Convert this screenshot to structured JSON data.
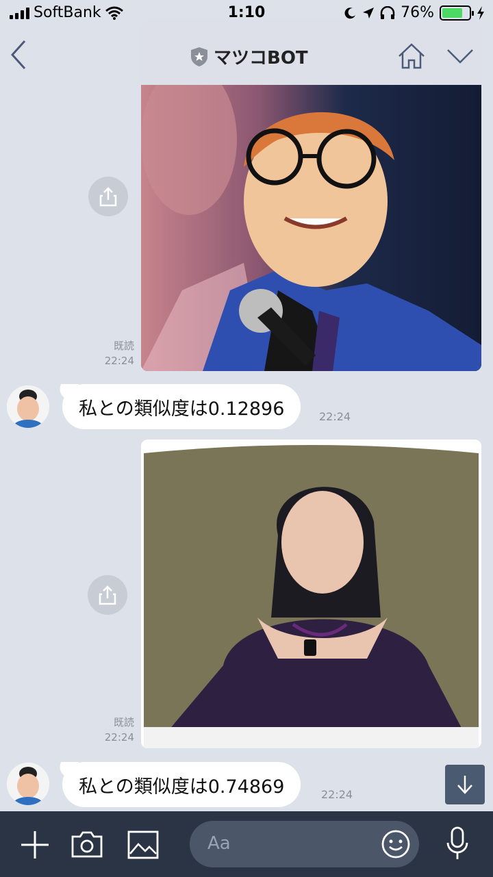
{
  "status_bar": {
    "carrier": "SoftBank",
    "time": "1:10",
    "battery": "76%",
    "battery_level": 0.76
  },
  "header": {
    "title": "マツコBOT"
  },
  "messages": [
    {
      "read_label": "既読",
      "time": "22:24"
    },
    {
      "text": "私との類似度は0.12896",
      "time": "22:24"
    },
    {
      "read_label": "既読",
      "time": "22:24"
    },
    {
      "text": "私との類似度は0.74869",
      "time": "22:24"
    }
  ],
  "footer": {
    "input_placeholder": "Aa"
  },
  "colors": {
    "battery_green": "#4cd964",
    "footer_bg": "#2b3444",
    "chat_bg": "#dde2ea"
  }
}
